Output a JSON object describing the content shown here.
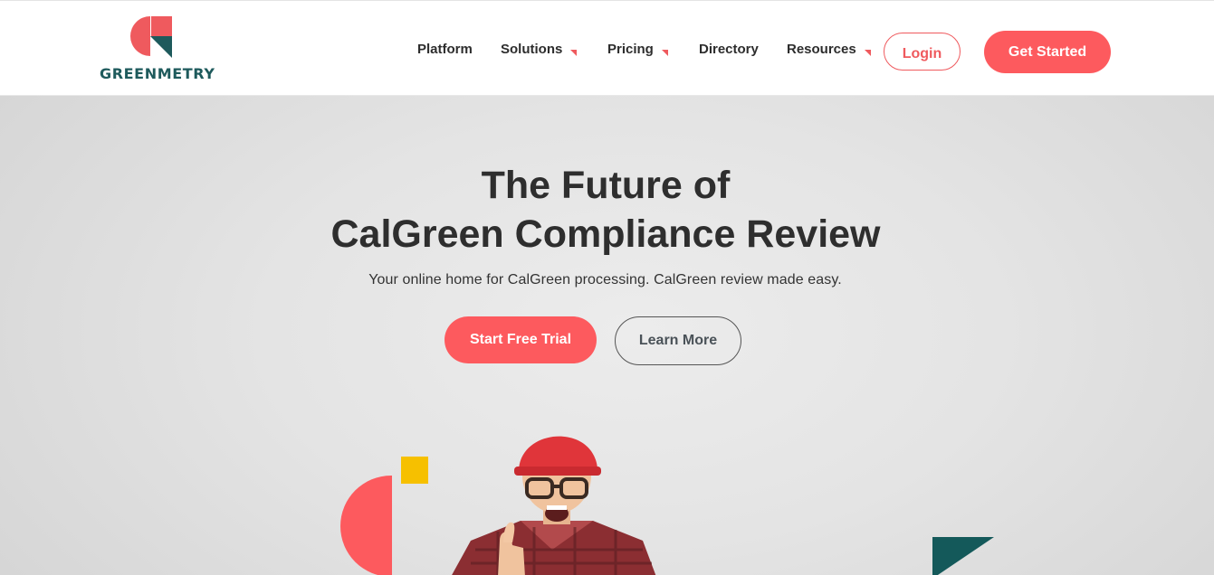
{
  "brand": {
    "name": "GREENMETRY",
    "colors": {
      "red": "#fd5a5e",
      "teal": "#1e5a5c",
      "yellow": "#f6c000"
    }
  },
  "nav": {
    "items": [
      {
        "label": "Platform",
        "has_dropdown": false
      },
      {
        "label": "Solutions",
        "has_dropdown": true
      },
      {
        "label": "Pricing",
        "has_dropdown": true
      },
      {
        "label": "Directory",
        "has_dropdown": false
      },
      {
        "label": "Resources",
        "has_dropdown": true
      }
    ],
    "login_label": "Login",
    "cta_label": "Get Started"
  },
  "hero": {
    "title_line1": "The Future of",
    "title_line2": "CalGreen Compliance Review",
    "subtitle": "Your online home for CalGreen processing. CalGreen review made easy.",
    "primary_button": "Start Free Trial",
    "secondary_button": "Learn More"
  }
}
